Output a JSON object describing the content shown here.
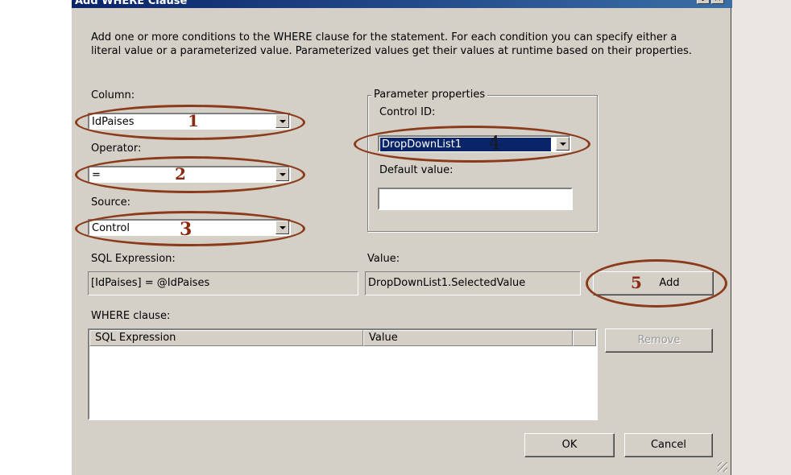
{
  "window": {
    "title": "Add WHERE Clause"
  },
  "description": "Add one or more conditions to the WHERE clause for the statement. For each condition you can specify either a literal value or a parameterized value. Parameterized values get their values at runtime based on their properties.",
  "column": {
    "label": "Column:",
    "value": "IdPaises"
  },
  "operator": {
    "label": "Operator:",
    "value": "="
  },
  "source": {
    "label": "Source:",
    "value": "Control"
  },
  "parameter_properties": {
    "title": "Parameter properties",
    "control_id_label": "Control ID:",
    "control_id_value": "DropDownList1",
    "default_value_label": "Default value:",
    "default_value": ""
  },
  "sql_expression": {
    "label": "SQL Expression:",
    "value": "[IdPaises] = @IdPaises"
  },
  "value": {
    "label": "Value:",
    "value": "DropDownList1.SelectedValue"
  },
  "where_clause": {
    "label": "WHERE clause:",
    "columns": [
      "SQL Expression",
      "Value"
    ]
  },
  "buttons": {
    "add": "Add",
    "remove": "Remove",
    "ok": "OK",
    "cancel": "Cancel"
  },
  "annotations": [
    "1",
    "2",
    "3",
    "4",
    "5"
  ]
}
